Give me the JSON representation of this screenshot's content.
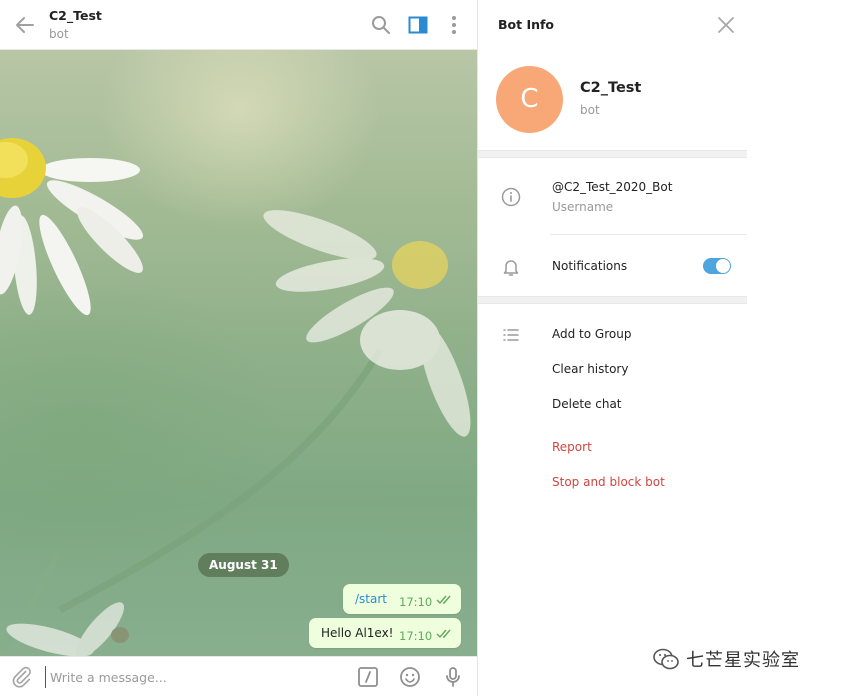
{
  "chat": {
    "title": "C2_Test",
    "subtitle": "bot",
    "date_divider": "August 31",
    "messages": [
      {
        "text": "/start",
        "time": "17:10",
        "is_command": true
      },
      {
        "text": "Hello Al1ex!",
        "time": "17:10",
        "is_command": false
      }
    ],
    "composer": {
      "placeholder": "Write a message...",
      "value": ""
    },
    "icons": [
      "back-arrow-icon",
      "search-icon",
      "sidebar-toggle-icon",
      "more-vertical-icon",
      "attach-icon",
      "bot-command-icon",
      "emoji-icon",
      "microphone-icon"
    ]
  },
  "bot_info": {
    "title": "Bot Info",
    "avatar_letter": "C",
    "avatar_color": "#f7a876",
    "name": "C2_Test",
    "subtitle": "bot",
    "username": "@C2_Test_2020_Bot",
    "username_label": "Username",
    "notifications_label": "Notifications",
    "notifications_enabled": true,
    "actions": [
      {
        "label": "Add to Group"
      },
      {
        "label": "Clear history"
      },
      {
        "label": "Delete chat"
      }
    ],
    "danger_actions": [
      {
        "label": "Report"
      },
      {
        "label": "Stop and block bot"
      }
    ]
  },
  "colors": {
    "accent": "#2a8bd3",
    "toggle_on": "#4ea4dc",
    "outgoing_bubble": "#efffde",
    "time_green": "#5faa5b",
    "danger": "#d0453f"
  },
  "watermark": "七芒星实验室"
}
